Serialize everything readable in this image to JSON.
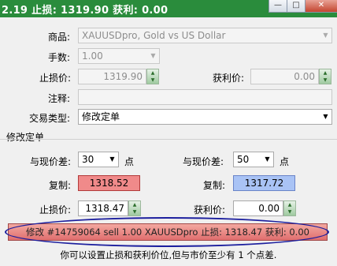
{
  "window": {
    "title": "2.19 止损: 1319.90 获利: 0.00",
    "min_glyph": "—",
    "max_glyph": "□",
    "close_glyph": "✕"
  },
  "form": {
    "symbol_label": "商品:",
    "symbol_value": "XAUUSDpro, Gold vs US Dollar",
    "volume_label": "手数:",
    "volume_value": "1.00",
    "stoploss_label": "止损价:",
    "stoploss_value": "1319.90",
    "takeprofit_label": "获利价:",
    "takeprofit_value": "0.00",
    "comment_label": "注释:",
    "comment_value": "",
    "type_label": "交易类型:",
    "type_value": "修改定单"
  },
  "modify": {
    "group_title": "修改定单",
    "sl_offset_label": "与现价差:",
    "sl_offset_value": "30",
    "sl_offset_unit": "点",
    "tp_offset_label": "与现价差:",
    "tp_offset_value": "50",
    "tp_offset_unit": "点",
    "sl_copy_label": "复制:",
    "sl_copy_value": "1318.52",
    "tp_copy_label": "复制:",
    "tp_copy_value": "1317.72",
    "sl_label": "止损价:",
    "sl_value": "1318.47",
    "tp_label": "获利价:",
    "tp_value": "0.00",
    "action_button": "修改 #14759064 sell 1.00 XAUUSDpro 止损: 1318.47 获利: 0.00",
    "hint": "你可以设置止损和获利价位,但与市价至少有 1 个点差."
  },
  "colors": {
    "titlebar": "#2a8c3c",
    "copy_red": "#f08a8a",
    "copy_blue": "#a9c3f5",
    "action_button": "#e88a86",
    "highlight": "#1c1f9e"
  }
}
